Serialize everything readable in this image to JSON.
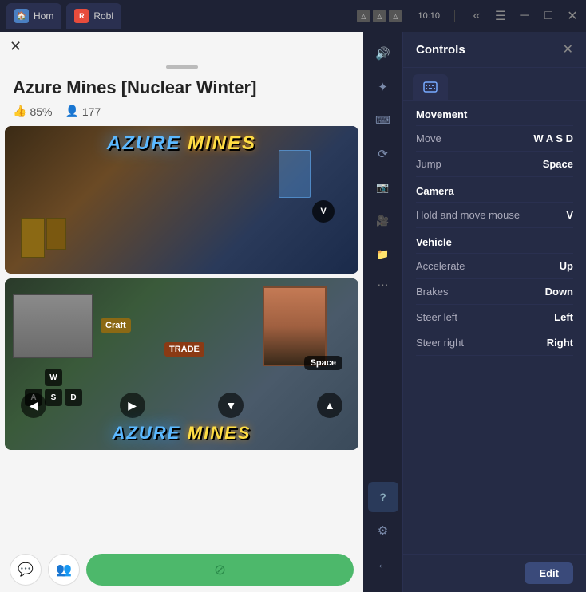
{
  "titlebar": {
    "tabs": [
      {
        "id": "home",
        "label": "Hom",
        "icon": "🏠"
      },
      {
        "id": "roblox",
        "label": "Robl",
        "icon": "R"
      }
    ],
    "menu_icon": "☰",
    "minimize": "─",
    "maximize": "□",
    "close": "✕",
    "back": "«",
    "time": "10:10",
    "tray_icons": [
      "△",
      "△",
      "△"
    ]
  },
  "app": {
    "title": "Azure Mines [Nuclear Winter]",
    "rating": "85%",
    "players": "177",
    "close_label": "✕",
    "scroll_handle": "",
    "expand_label": "^",
    "screenshot1": {
      "key": "V",
      "game_title_azure": "AZURE",
      "game_title_mines": "MINES"
    },
    "screenshot2": {
      "craft_label": "Craft",
      "trade_label": "TRADE",
      "space_key": "Space",
      "wasd_keys": [
        "W",
        "A",
        "S",
        "D"
      ],
      "nav_arrows": [
        "◀",
        "▶",
        "▼",
        "▲"
      ],
      "game_title_azure": "AZURE",
      "game_title_mines": "MINES"
    }
  },
  "sidebar": {
    "buttons": [
      {
        "id": "volume",
        "icon": "🔊",
        "active": false
      },
      {
        "id": "touch",
        "icon": "⊹",
        "active": false
      },
      {
        "id": "keyboard",
        "icon": "⌨",
        "active": false
      },
      {
        "id": "rotate",
        "icon": "⟳",
        "active": false
      },
      {
        "id": "camera",
        "icon": "📷",
        "active": false
      },
      {
        "id": "video",
        "icon": "🎥",
        "active": false
      },
      {
        "id": "folder",
        "icon": "📁",
        "active": false
      }
    ],
    "dots": "···",
    "help": "?",
    "settings": "⚙",
    "back": "←"
  },
  "controls": {
    "title": "Controls",
    "close": "✕",
    "tab_icon": "⌨",
    "sections": [
      {
        "id": "movement",
        "label": "Movement",
        "rows": [
          {
            "label": "Move",
            "value": "W A S D"
          },
          {
            "label": "Jump",
            "value": "Space"
          }
        ]
      },
      {
        "id": "camera",
        "label": "Camera",
        "rows": [
          {
            "label": "Hold and move mouse",
            "value": "V"
          }
        ]
      },
      {
        "id": "vehicle",
        "label": "Vehicle",
        "rows": [
          {
            "label": "Accelerate",
            "value": "Up"
          },
          {
            "label": "Brakes",
            "value": "Down"
          },
          {
            "label": "Steer left",
            "value": "Left"
          },
          {
            "label": "Steer right",
            "value": "Right"
          }
        ]
      }
    ],
    "edit_label": "Edit"
  },
  "bottom": {
    "chat_icon": "💬",
    "users_icon": "👥",
    "install_icon": "⊘"
  }
}
